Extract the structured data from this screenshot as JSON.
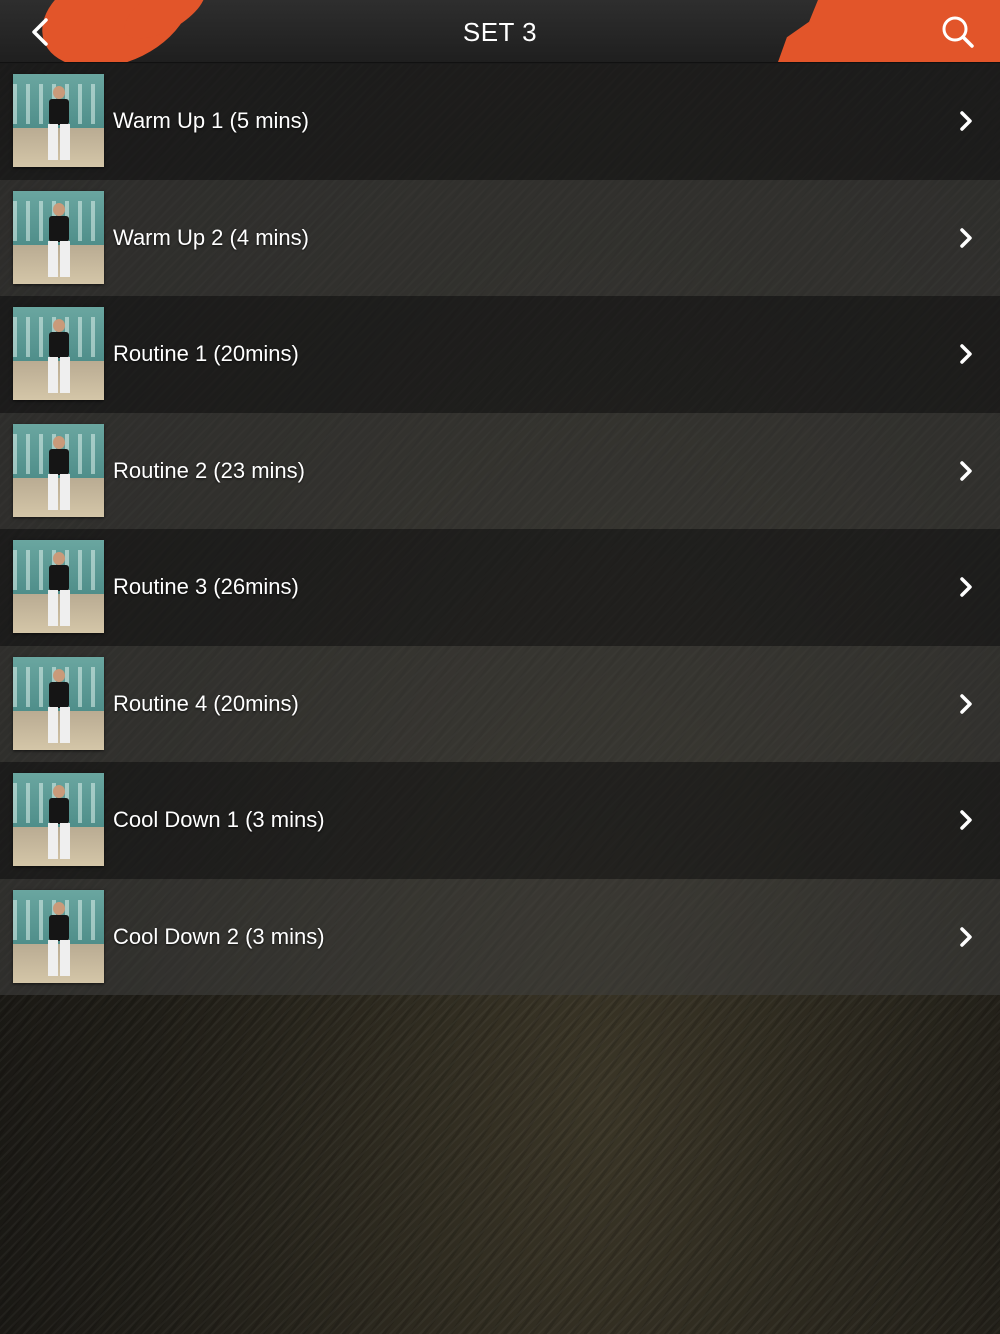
{
  "header": {
    "title": "SET 3",
    "back_icon": "chevron-left-icon",
    "search_icon": "search-icon",
    "accent_color": "#e2552a"
  },
  "items": [
    {
      "label": "Warm Up 1 (5 mins)"
    },
    {
      "label": "Warm Up 2 (4 mins)"
    },
    {
      "label": "Routine 1 (20mins)"
    },
    {
      "label": "Routine 2 (23 mins)"
    },
    {
      "label": "Routine 3 (26mins)"
    },
    {
      "label": "Routine 4 (20mins)"
    },
    {
      "label": "Cool Down 1 (3 mins)"
    },
    {
      "label": "Cool Down 2 (3 mins)"
    }
  ]
}
